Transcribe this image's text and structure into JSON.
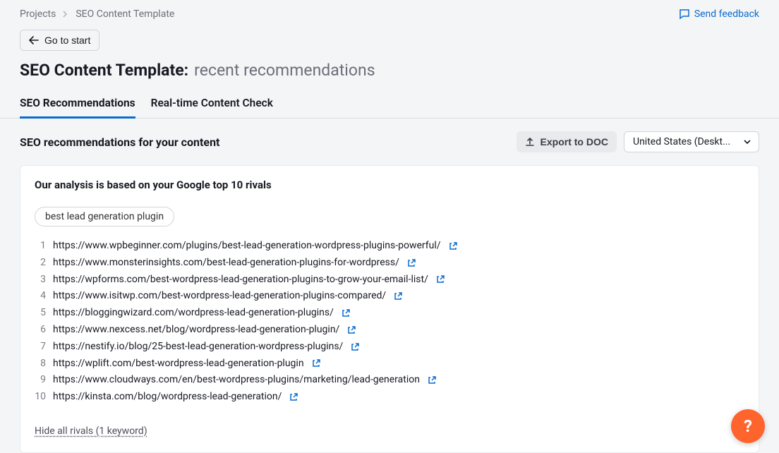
{
  "breadcrumb": {
    "root": "Projects",
    "current": "SEO Content Template"
  },
  "feedback_label": "Send feedback",
  "go_to_start_label": "Go to start",
  "page_title_prefix": "SEO Content Template:",
  "page_title_suffix": "recent recommendations",
  "tabs": [
    {
      "label": "SEO Recommendations",
      "active": true
    },
    {
      "label": "Real-time Content Check",
      "active": false
    }
  ],
  "section_title": "SEO recommendations for your content",
  "export_label": "Export to DOC",
  "locale_select": "United States (Deskt...",
  "card": {
    "title": "Our analysis is based on your Google top 10 rivals",
    "keyword": "best lead generation plugin",
    "rivals": [
      "https://www.wpbeginner.com/plugins/best-lead-generation-wordpress-plugins-powerful/",
      "https://www.monsterinsights.com/best-lead-generation-plugins-for-wordpress/",
      "https://wpforms.com/best-wordpress-lead-generation-plugins-to-grow-your-email-list/",
      "https://www.isitwp.com/best-wordpress-lead-generation-plugins-compared/",
      "https://bloggingwizard.com/wordpress-lead-generation-plugins/",
      "https://www.nexcess.net/blog/wordpress-lead-generation-plugin/",
      "https://nestify.io/blog/25-best-lead-generation-wordpress-plugins/",
      "https://wplift.com/best-wordpress-lead-generation-plugin",
      "https://www.cloudways.com/en/best-wordpress-plugins/marketing/lead-generation",
      "https://kinsta.com/blog/wordpress-lead-generation/"
    ],
    "hide_link": "Hide all rivals (1 keyword)"
  },
  "fab_label": "?"
}
